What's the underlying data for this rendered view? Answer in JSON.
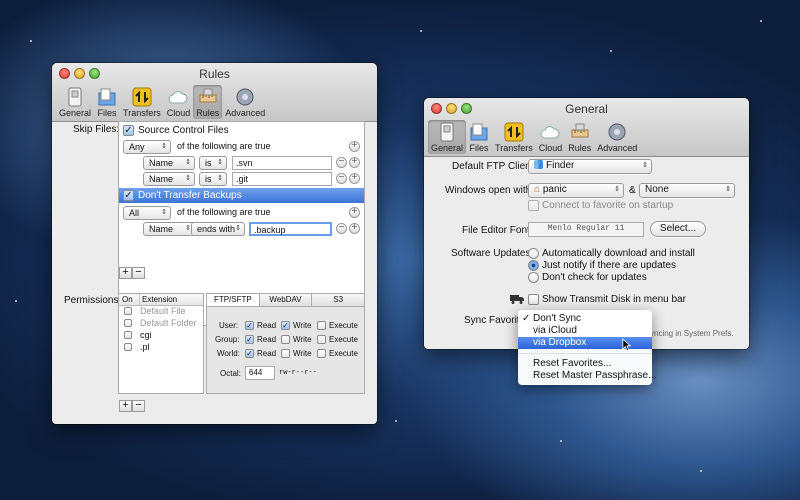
{
  "rules_window": {
    "title": "Rules",
    "tabs": [
      {
        "label": "General",
        "icon": "general-switch-icon"
      },
      {
        "label": "Files",
        "icon": "files-icon"
      },
      {
        "label": "Transfers",
        "icon": "transfers-arrows-icon"
      },
      {
        "label": "Cloud",
        "icon": "cloud-icon"
      },
      {
        "label": "Rules",
        "icon": "rules-ruler-icon"
      },
      {
        "label": "Advanced",
        "icon": "advanced-gear-icon"
      }
    ],
    "skip_files_label": "Skip Files:",
    "rule1": {
      "label": "Source Control Files",
      "match": "Any",
      "match_suffix": "of the following are true",
      "conditions": [
        {
          "field": "Name",
          "op": "is",
          "value": ".svn"
        },
        {
          "field": "Name",
          "op": "is",
          "value": ".git"
        }
      ]
    },
    "rule2": {
      "label": "Don't Transfer Backups",
      "match": "All",
      "match_suffix": "of the following are true",
      "conditions": [
        {
          "field": "Name",
          "op": "ends with",
          "value": ".backup"
        }
      ]
    },
    "add_symbol": "+",
    "remove_symbol": "−",
    "permissions_label": "Permissions:",
    "perm_columns": {
      "on": "On",
      "extension": "Extension"
    },
    "perm_rows": [
      "Default File",
      "Default Folder",
      "cgi",
      ".pl"
    ],
    "perm_tabs": [
      "FTP/SFTP",
      "WebDAV",
      "S3"
    ],
    "perm_groups": [
      {
        "label": "User:",
        "read": "Read",
        "write": "Write",
        "execute": "Execute"
      },
      {
        "label": "Group:",
        "read": "Read",
        "write": "Write",
        "execute": "Execute"
      },
      {
        "label": "World:",
        "read": "Read",
        "write": "Write",
        "execute": "Execute"
      }
    ],
    "octal_label": "Octal:",
    "octal_value": "644",
    "octal_symbolic": "rw-r--r--"
  },
  "general_window": {
    "title": "General",
    "tabs": [
      {
        "label": "General",
        "icon": "general-switch-icon"
      },
      {
        "label": "Files",
        "icon": "files-icon"
      },
      {
        "label": "Transfers",
        "icon": "transfers-arrows-icon"
      },
      {
        "label": "Cloud",
        "icon": "cloud-icon"
      },
      {
        "label": "Rules",
        "icon": "rules-ruler-icon"
      },
      {
        "label": "Advanced",
        "icon": "advanced-gear-icon"
      }
    ],
    "default_ftp_client_label": "Default FTP Client:",
    "default_ftp_client_value": "Finder",
    "windows_open_label": "Windows open with:",
    "windows_open_value": "panic",
    "windows_open_amp": "&",
    "windows_open_second": "None",
    "connect_favorite_label": "Connect to favorite on startup",
    "file_editor_font_label": "File Editor Font:",
    "file_editor_font_value": "Menlo Regular 11",
    "select_button": "Select...",
    "software_updates_label": "Software Updates:",
    "updates_options": [
      "Automatically download and install",
      "Just notify if there are updates",
      "Don't check for updates"
    ],
    "show_transmit_disk_label": "Show Transmit Disk in menu bar",
    "sync_favorites_label": "Sync Favorites:",
    "sync_note": "yncing in System Prefs.",
    "sync_menu": {
      "check": "✓",
      "items": [
        "Don't Sync",
        "via iCloud",
        "via Dropbox"
      ],
      "extra_items": [
        "Reset Favorites...",
        "Reset Master Passphrase..."
      ]
    }
  }
}
